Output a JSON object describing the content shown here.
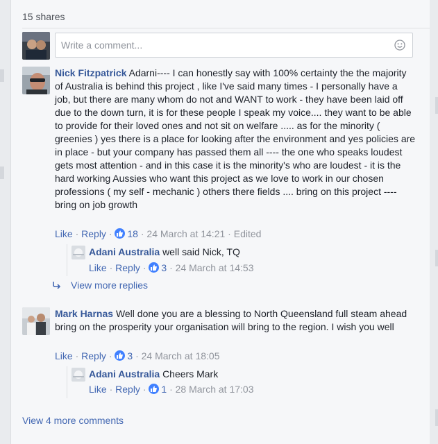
{
  "shares_label": "15 shares",
  "composer": {
    "placeholder": "Write a comment..."
  },
  "comments": [
    {
      "author": "Nick Fitzpatrick",
      "text": "Adarni---- I can honestly say with 100% certainty the the majority of Australia is behind this project , like I've said many times - I personally have a job, but there are many whom do not and WANT to work - they have been laid off due to the down turn, it is for these people I speak my voice.... they want to be able to provide for their loved ones and not sit on welfare ..... as for the minority ( greenies ) yes there is a place for looking after the environment and yes policies are in place - but your company has passed them all ---- the one who speaks loudest gets most attention - and in this case it is the minority's who are loudest - it is the hard working Aussies who want this project as we love to work in our chosen professions ( my self - mechanic ) others there fields .... bring on this project ---- bring on job growth",
      "like": "Like",
      "reply": "Reply",
      "reactions": "18",
      "time": "24 March at 14:21",
      "edited": "Edited",
      "reply_item": {
        "author": "Adani Australia",
        "text": "well said Nick, TQ",
        "like": "Like",
        "reply": "Reply",
        "reactions": "3",
        "time": "24 March at 14:53"
      },
      "view_more_replies": "View more replies"
    },
    {
      "author": "Mark Harnas",
      "text": "Well done you are a blessing to North Queensland full steam ahead bring on the prosperity your organisation will bring to the region. I wish you well",
      "like": "Like",
      "reply": "Reply",
      "reactions": "3",
      "time": "24 March at 18:05",
      "reply_item": {
        "author": "Adani Australia",
        "text": "Cheers Mark",
        "like": "Like",
        "reply": "Reply",
        "reactions": "1",
        "time": "28 March at 17:03"
      }
    }
  ],
  "view_more_comments": "View 4 more comments",
  "colors": {
    "link": "#365899",
    "action": "#4267b2",
    "meta": "#90949c",
    "like_badge": "#4080ff"
  }
}
